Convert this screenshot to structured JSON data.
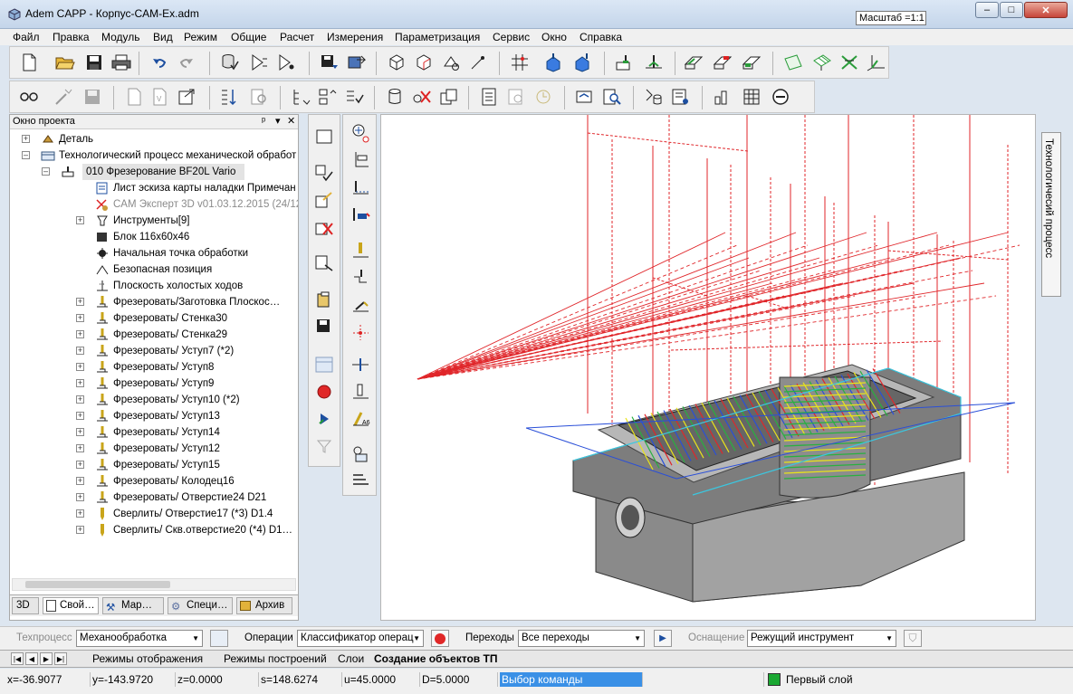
{
  "window": {
    "title": "Adem CAPP - Корпус-CAM-Ex.adm",
    "scale_label": "Масштаб =1:1",
    "min_glyph": "–",
    "max_glyph": "□",
    "close_glyph": "✕"
  },
  "menu": [
    "Файл",
    "Правка",
    "Модуль",
    "Вид",
    "Режим",
    "Общие",
    "Расчет",
    "Измерения",
    "Параметризация",
    "Сервис",
    "Окно",
    "Справка"
  ],
  "project_panel": {
    "title": "Окно проекта",
    "pin_glyph": "ᵖ",
    "dropdown_glyph": "▾",
    "close_glyph": "✕",
    "tree": [
      {
        "label": "Деталь",
        "expander": "+",
        "icon": "part-icon",
        "level": 0
      },
      {
        "label": "Технологический процесс механической обработ",
        "expander": "–",
        "icon": "process-icon",
        "level": 0
      },
      {
        "label": "010  Фрезерование BF20L Vario",
        "expander": "–",
        "icon": "machine-icon",
        "level": 1,
        "selected": true
      },
      {
        "label": "Лист эскиза карты наладки  Примечан",
        "expander": "",
        "icon": "sheet-icon",
        "level": 2
      },
      {
        "label": "CAM Эксперт 3D v01.03.12.2015 (24/12",
        "expander": "",
        "icon": "cam-icon",
        "level": 2,
        "muted": true
      },
      {
        "label": "Инструменты[9]",
        "expander": "+",
        "icon": "tools-icon",
        "level": 2
      },
      {
        "label": "Блок 116x60x46",
        "expander": "",
        "icon": "block-icon",
        "level": 2
      },
      {
        "label": "Начальная точка обработки",
        "expander": "",
        "icon": "start-point-icon",
        "level": 2
      },
      {
        "label": "Безопасная позиция",
        "expander": "",
        "icon": "safe-position-icon",
        "level": 2
      },
      {
        "label": "Плоскость холостых ходов",
        "expander": "",
        "icon": "plane-icon",
        "level": 2
      },
      {
        "label": "Фрезеровать/Заготовка Плоскос…",
        "expander": "+",
        "icon": "mill-icon",
        "level": 2
      },
      {
        "label": "Фрезеровать/ Стенка30",
        "expander": "+",
        "icon": "mill-icon",
        "level": 2
      },
      {
        "label": "Фрезеровать/ Стенка29",
        "expander": "+",
        "icon": "mill-icon",
        "level": 2
      },
      {
        "label": "Фрезеровать/ Уступ7 (*2)",
        "expander": "+",
        "icon": "mill-icon",
        "level": 2
      },
      {
        "label": "Фрезеровать/ Уступ8",
        "expander": "+",
        "icon": "mill-icon",
        "level": 2
      },
      {
        "label": "Фрезеровать/ Уступ9",
        "expander": "+",
        "icon": "mill-icon",
        "level": 2
      },
      {
        "label": "Фрезеровать/ Уступ10 (*2)",
        "expander": "+",
        "icon": "mill-icon",
        "level": 2
      },
      {
        "label": "Фрезеровать/ Уступ13",
        "expander": "+",
        "icon": "mill-icon",
        "level": 2
      },
      {
        "label": "Фрезеровать/ Уступ14",
        "expander": "+",
        "icon": "mill-icon",
        "level": 2
      },
      {
        "label": "Фрезеровать/ Уступ12",
        "expander": "+",
        "icon": "mill-icon",
        "level": 2
      },
      {
        "label": "Фрезеровать/ Уступ15",
        "expander": "+",
        "icon": "mill-icon",
        "level": 2
      },
      {
        "label": "Фрезеровать/ Колодец16",
        "expander": "+",
        "icon": "mill-icon",
        "level": 2
      },
      {
        "label": "Фрезеровать/ Отверстие24 D21",
        "expander": "+",
        "icon": "mill-icon",
        "level": 2
      },
      {
        "label": "Сверлить/ Отверстие17 (*3) D1.4",
        "expander": "+",
        "icon": "drill-icon",
        "level": 2
      },
      {
        "label": "Сверлить/ Скв.отверстие20 (*4) D1…",
        "expander": "+",
        "icon": "drill-icon",
        "level": 2
      }
    ],
    "tabs": [
      "3D",
      "Свой…",
      "Мар…",
      "Специ…",
      "Архив"
    ]
  },
  "side_panel_title": "Технологичесий процесс",
  "operations_bar": {
    "techprocess_label": "Техпроцесс",
    "techprocess_value": "Механообработка",
    "operations_label": "Операции",
    "operations_value": "Классификатор операц",
    "transitions_label": "Переходы",
    "transitions_value": "Все переходы",
    "equipment_label": "Оснащение",
    "equipment_value": "Режущий инструмент"
  },
  "bottom_tabs": [
    "Режимы отображения",
    "Режимы построений",
    "Слои",
    "Создание объектов ТП"
  ],
  "status": {
    "x": "x=-36.9077",
    "y": "y=-143.9720",
    "z": "z=0.0000",
    "s": "s=148.6274",
    "u": "u=45.0000",
    "d": "D=5.0000",
    "prompt": "Выбор команды",
    "layer": "Первый слой",
    "layer_color": "#1aa832"
  },
  "colors": {
    "toolpath_red": "#e0262a",
    "toolpath_blue": "#2a4fd8",
    "toolpath_green": "#28b040",
    "toolpath_yellow": "#e9e41a",
    "part_gray": "#8c8c8c",
    "selection_blue": "#3b85e0"
  }
}
